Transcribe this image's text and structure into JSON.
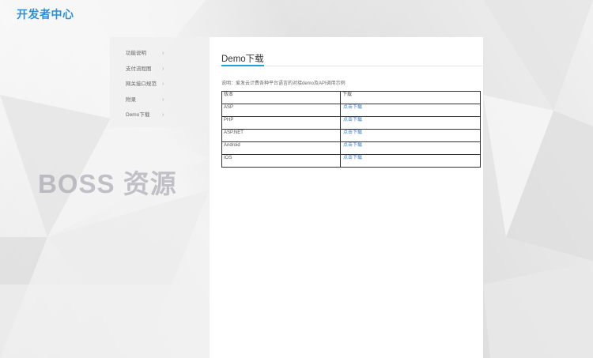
{
  "header": {
    "title": "开发者中心"
  },
  "watermark": "BOSS 资源",
  "sidebar": {
    "items": [
      {
        "label": "功能说明",
        "chevron": "›"
      },
      {
        "label": "支付流程图",
        "chevron": "›"
      },
      {
        "label": "网关接口规范",
        "chevron": "›"
      },
      {
        "label": "附录",
        "chevron": "›"
      },
      {
        "label": "Demo下载",
        "chevron": "›"
      }
    ]
  },
  "main": {
    "title": "Demo下载",
    "description": "说明：爱发云计费各种平台语言的对接demo及API调用示例",
    "table": {
      "headers": [
        "版本",
        "下载"
      ],
      "rows": [
        {
          "version": "ASP",
          "link": "点击下载"
        },
        {
          "version": "PHP",
          "link": "点击下载"
        },
        {
          "version": "ASP.NET",
          "link": "点击下载"
        },
        {
          "version": "Android",
          "link": "点击下载"
        },
        {
          "version": "IOS",
          "link": "点击下载"
        }
      ]
    }
  },
  "colors": {
    "accent": "#23a0d6",
    "brand": "#2f8fd6",
    "link": "#3a7bbf"
  }
}
